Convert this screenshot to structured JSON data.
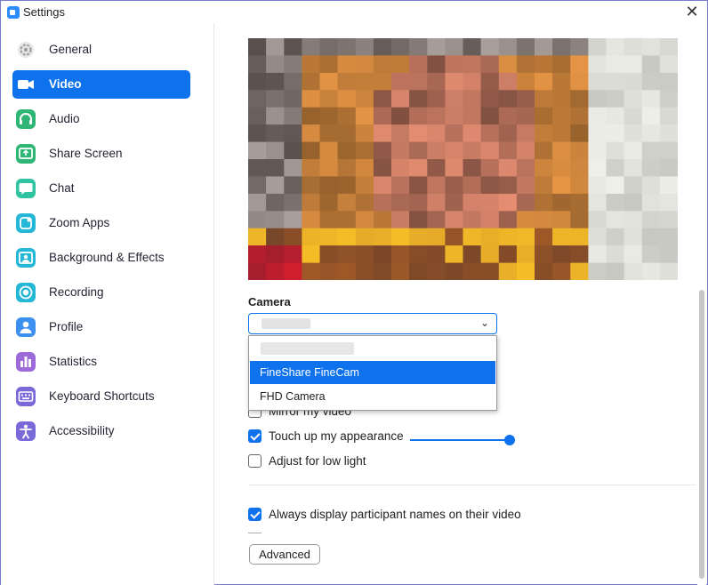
{
  "window": {
    "title": "Settings",
    "close_icon": "close-icon"
  },
  "sidebar": {
    "items": [
      {
        "label": "General",
        "icon": "gear-icon",
        "color": "#9e9e9e"
      },
      {
        "label": "Video",
        "icon": "video-camera-icon",
        "color": "#ffffff"
      },
      {
        "label": "Audio",
        "icon": "headphones-icon",
        "color": "#2fb674"
      },
      {
        "label": "Share Screen",
        "icon": "share-screen-icon",
        "color": "#2fb674"
      },
      {
        "label": "Chat",
        "icon": "chat-bubble-icon",
        "color": "#2fc3a1"
      },
      {
        "label": "Zoom Apps",
        "icon": "apps-icon",
        "color": "#25b8d6"
      },
      {
        "label": "Background & Effects",
        "icon": "background-icon",
        "color": "#25b8d6"
      },
      {
        "label": "Recording",
        "icon": "record-icon",
        "color": "#25b8d6"
      },
      {
        "label": "Profile",
        "icon": "person-icon",
        "color": "#3d8ff0"
      },
      {
        "label": "Statistics",
        "icon": "bar-chart-icon",
        "color": "#9c6ad9"
      },
      {
        "label": "Keyboard Shortcuts",
        "icon": "keyboard-icon",
        "color": "#7a6ad9"
      },
      {
        "label": "Accessibility",
        "icon": "accessibility-icon",
        "color": "#7a6ad9"
      }
    ],
    "active_index": 1,
    "accent": "#0e72ed"
  },
  "video": {
    "camera_label": "Camera",
    "camera_options": [
      "FineShare FineCam",
      "FHD Camera"
    ],
    "selected_option": "FineShare FineCam",
    "mirror_label": "Mirror my video",
    "touch_up_label": "Touch up my appearance",
    "touch_up_checked": true,
    "touch_up_level": 1.0,
    "low_light_label": "Adjust for low light",
    "low_light_checked": false,
    "names_label": "Always display participant names on their video",
    "names_checked": true,
    "advanced_label": "Advanced"
  }
}
